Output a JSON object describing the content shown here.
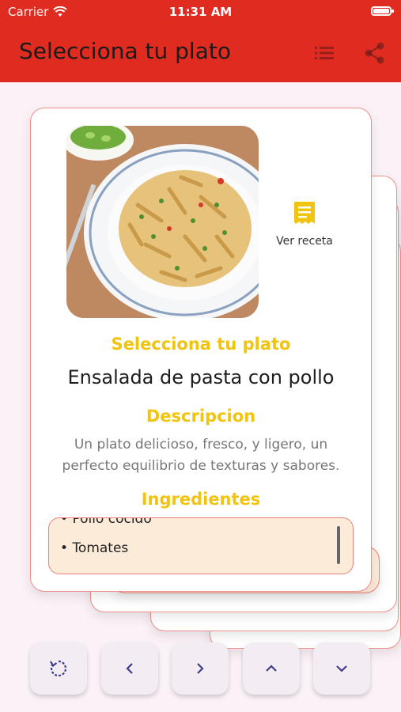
{
  "status": {
    "carrier": "Carrier",
    "time": "11:31 AM"
  },
  "appbar": {
    "title": "Selecciona tu plato",
    "list_icon": "list-icon",
    "share_icon": "share-icon"
  },
  "card": {
    "image_alt": "pasta-dish-photo",
    "recipe_label": "Ver receta",
    "recipe_icon": "receipt-icon",
    "section_select": "Selecciona tu plato",
    "dish_name": "Ensalada de pasta con pollo",
    "section_desc": "Descripcion",
    "description_line1": "Un plato delicioso, fresco, y ligero, un",
    "description_line2": "perfecto equilibrio de texturas y sabores.",
    "section_ingredients": "Ingredientes",
    "ingredients": [
      "Pollo cocido",
      "Tomates"
    ]
  },
  "controls": [
    "refresh-icon",
    "chevron-left-icon",
    "chevron-right-icon",
    "chevron-up-icon",
    "chevron-down-icon"
  ],
  "colors": {
    "appbar": "#e02b20",
    "accent_heading": "#f1c40f",
    "card_border": "#ef8f8a",
    "background": "#fbf2f8"
  }
}
